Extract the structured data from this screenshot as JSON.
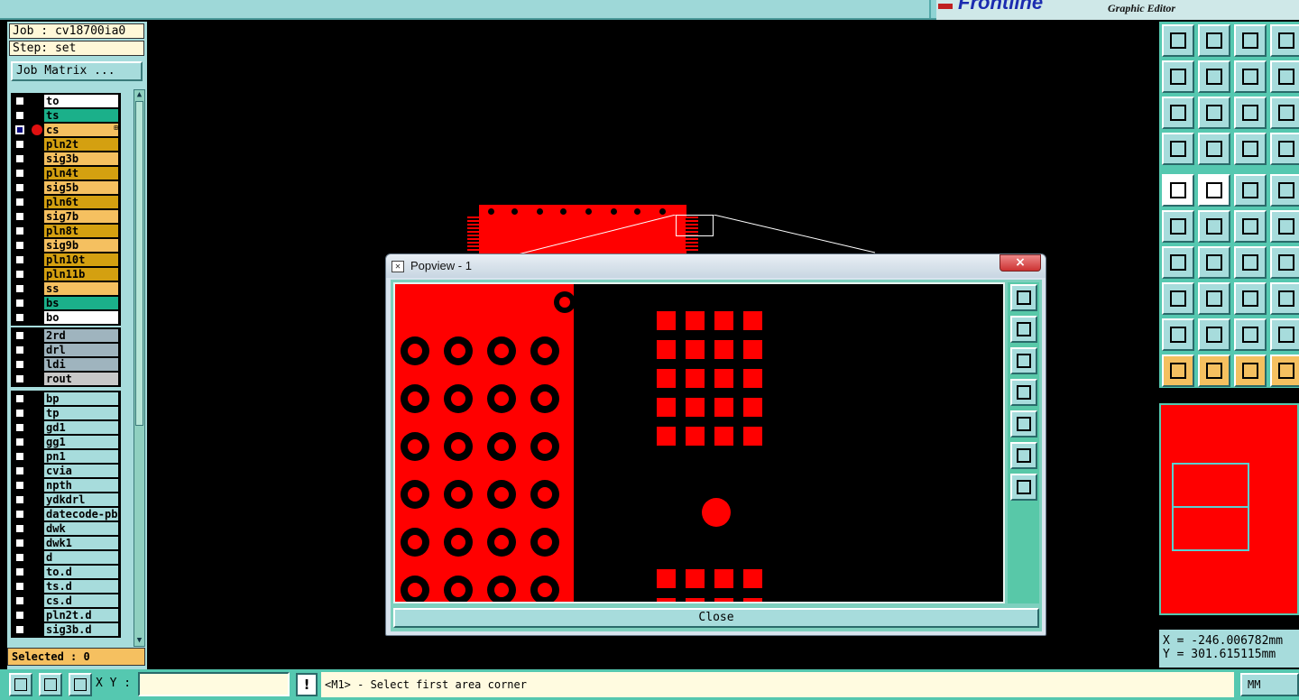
{
  "app": {
    "brand": "Frontline",
    "subtitle": "Graphic Editor"
  },
  "job": {
    "job_line": "Job : cv18700ia0",
    "step_line": "Step: set",
    "matrix_button": "Job Matrix ..."
  },
  "layers": {
    "group1": [
      {
        "name": "to",
        "color": "#ffffff"
      },
      {
        "name": "ts",
        "color": "#1bb08a"
      },
      {
        "name": "cs",
        "color": "#f5c060",
        "active": true,
        "mark": "⊞"
      },
      {
        "name": "pln2t",
        "color": "#d4a010"
      },
      {
        "name": "sig3b",
        "color": "#f5c060"
      },
      {
        "name": "pln4t",
        "color": "#d4a010"
      },
      {
        "name": "sig5b",
        "color": "#f5c060"
      },
      {
        "name": "pln6t",
        "color": "#d4a010"
      },
      {
        "name": "sig7b",
        "color": "#f5c060"
      },
      {
        "name": "pln8t",
        "color": "#d4a010"
      },
      {
        "name": "sig9b",
        "color": "#f5c060"
      },
      {
        "name": "pln10t",
        "color": "#d4a010"
      },
      {
        "name": "pln11b",
        "color": "#d4a010"
      },
      {
        "name": "ss",
        "color": "#f5c060"
      },
      {
        "name": "bs",
        "color": "#1bb08a"
      },
      {
        "name": "bo",
        "color": "#ffffff"
      }
    ],
    "group2": [
      {
        "name": "2rd",
        "color": "#9fb4be"
      },
      {
        "name": "drl",
        "color": "#9fb4be"
      },
      {
        "name": "ldi",
        "color": "#9fb4be"
      },
      {
        "name": "rout",
        "color": "#c8c8c8"
      }
    ],
    "group3": [
      {
        "name": "bp",
        "color": "#a7dcdc"
      },
      {
        "name": "tp",
        "color": "#a7dcdc"
      },
      {
        "name": "gd1",
        "color": "#a7dcdc"
      },
      {
        "name": "gg1",
        "color": "#a7dcdc"
      },
      {
        "name": "pn1",
        "color": "#a7dcdc"
      },
      {
        "name": "cvia",
        "color": "#a7dcdc"
      },
      {
        "name": "npth",
        "color": "#a7dcdc"
      },
      {
        "name": "ydkdrl",
        "color": "#a7dcdc"
      },
      {
        "name": "datecode-pbe",
        "color": "#a7dcdc"
      },
      {
        "name": "dwk",
        "color": "#a7dcdc"
      },
      {
        "name": "dwk1",
        "color": "#a7dcdc"
      },
      {
        "name": "d",
        "color": "#a7dcdc"
      },
      {
        "name": "to.d",
        "color": "#a7dcdc"
      },
      {
        "name": "ts.d",
        "color": "#a7dcdc"
      },
      {
        "name": "cs.d",
        "color": "#a7dcdc"
      },
      {
        "name": "pln2t.d",
        "color": "#a7dcdc"
      },
      {
        "name": "sig3b.d",
        "color": "#a7dcdc"
      }
    ]
  },
  "selected": "Selected : 0",
  "popview": {
    "title": "Popview - 1",
    "close_x": "×",
    "close_button": "Close"
  },
  "coords": {
    "x": "X = -246.006782mm",
    "y": "Y = 301.615115mm"
  },
  "bottom": {
    "xy_label": "X Y :",
    "xy_value": "",
    "warn": "!",
    "status": "<M1> - Select first area corner",
    "units": "MM"
  },
  "colors": {
    "copper": "#ff0000",
    "panel": "#a7dcdc",
    "accent": "#55c8b0"
  }
}
